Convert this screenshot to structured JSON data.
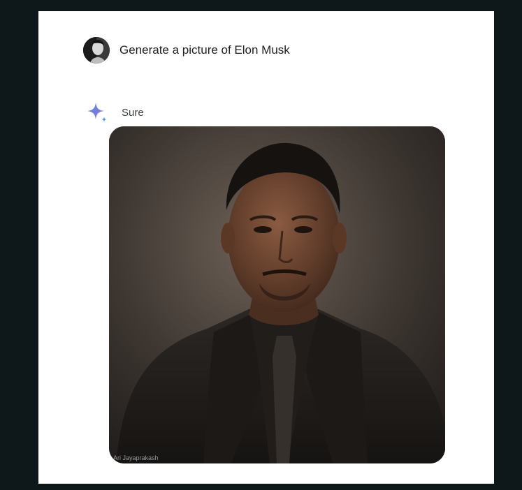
{
  "conversation": {
    "user_message": {
      "text": "Generate a picture of Elon Musk",
      "avatar_icon": "user-avatar"
    },
    "assistant_message": {
      "text": "Sure",
      "icon": "sparkle-icon",
      "image": {
        "watermark": "Ari Jayaprakash"
      }
    }
  },
  "colors": {
    "outer_background": "#0e1719",
    "card_background": "#ffffff",
    "sparkle_blue": "#4b8ee6",
    "sparkle_purple": "#9b72cb"
  }
}
